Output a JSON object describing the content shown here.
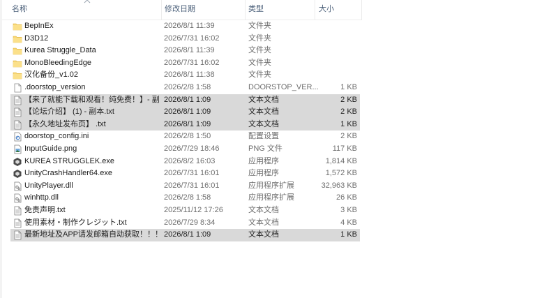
{
  "header": {
    "name": "名称",
    "date": "修改日期",
    "type": "类型",
    "size": "大小"
  },
  "files": [
    {
      "name": "BepInEx",
      "date": "2026/8/1 11:39",
      "type": "文件夹",
      "size": "",
      "icon": "folder-icon",
      "selected": false
    },
    {
      "name": "D3D12",
      "date": "2026/7/31 16:02",
      "type": "文件夹",
      "size": "",
      "icon": "folder-icon",
      "selected": false
    },
    {
      "name": "Kurea Struggle_Data",
      "date": "2026/8/1 11:39",
      "type": "文件夹",
      "size": "",
      "icon": "folder-icon",
      "selected": false
    },
    {
      "name": "MonoBleedingEdge",
      "date": "2026/7/31 16:02",
      "type": "文件夹",
      "size": "",
      "icon": "folder-icon",
      "selected": false
    },
    {
      "name": "汉化备份_v1.02",
      "date": "2026/8/1 11:38",
      "type": "文件夹",
      "size": "",
      "icon": "folder-icon",
      "selected": false
    },
    {
      "name": ".doorstop_version",
      "date": "2026/2/8 1:58",
      "type": "DOORSTOP_VER...",
      "size": "1 KB",
      "icon": "file-icon",
      "selected": false
    },
    {
      "name": "【来了就能下载和观看！纯免费！】- 副...",
      "date": "2026/8/1 1:09",
      "type": "文本文档",
      "size": "2 KB",
      "icon": "text-file-icon",
      "selected": true
    },
    {
      "name": "【论坛介绍】 (1) - 副本.txt",
      "date": "2026/8/1 1:09",
      "type": "文本文档",
      "size": "2 KB",
      "icon": "text-file-icon",
      "selected": true
    },
    {
      "name": "【永久地址发布页】 .txt",
      "date": "2026/8/1 1:09",
      "type": "文本文档",
      "size": "1 KB",
      "icon": "text-file-icon",
      "selected": true
    },
    {
      "name": "doorstop_config.ini",
      "date": "2026/2/8 1:50",
      "type": "配置设置",
      "size": "2 KB",
      "icon": "config-file-icon",
      "selected": false
    },
    {
      "name": "InputGuide.png",
      "date": "2026/7/29 18:46",
      "type": "PNG 文件",
      "size": "117 KB",
      "icon": "image-file-icon",
      "selected": false
    },
    {
      "name": "KUREA STRUGGLEK.exe",
      "date": "2026/8/2 16:03",
      "type": "应用程序",
      "size": "1,814 KB",
      "icon": "unity-app-icon",
      "selected": false
    },
    {
      "name": "UnityCrashHandler64.exe",
      "date": "2026/7/31 16:01",
      "type": "应用程序",
      "size": "1,572 KB",
      "icon": "unity-app-icon",
      "selected": false
    },
    {
      "name": "UnityPlayer.dll",
      "date": "2026/7/31 16:01",
      "type": "应用程序扩展",
      "size": "32,963 KB",
      "icon": "dll-file-icon",
      "selected": false
    },
    {
      "name": "winhttp.dll",
      "date": "2026/2/8 1:58",
      "type": "应用程序扩展",
      "size": "26 KB",
      "icon": "dll-file-icon",
      "selected": false
    },
    {
      "name": "免责声明.txt",
      "date": "2025/11/12 17:26",
      "type": "文本文档",
      "size": "3 KB",
      "icon": "text-file-icon",
      "selected": false
    },
    {
      "name": "使用素材・制作クレジット.txt",
      "date": "2026/7/29 8:34",
      "type": "文本文档",
      "size": "4 KB",
      "icon": "text-file-icon",
      "selected": false
    },
    {
      "name": "最新地址及APP请发邮箱自动获取！！！...",
      "date": "2026/8/1 1:09",
      "type": "文本文档",
      "size": "1 KB",
      "icon": "text-file-icon",
      "selected": true
    }
  ]
}
